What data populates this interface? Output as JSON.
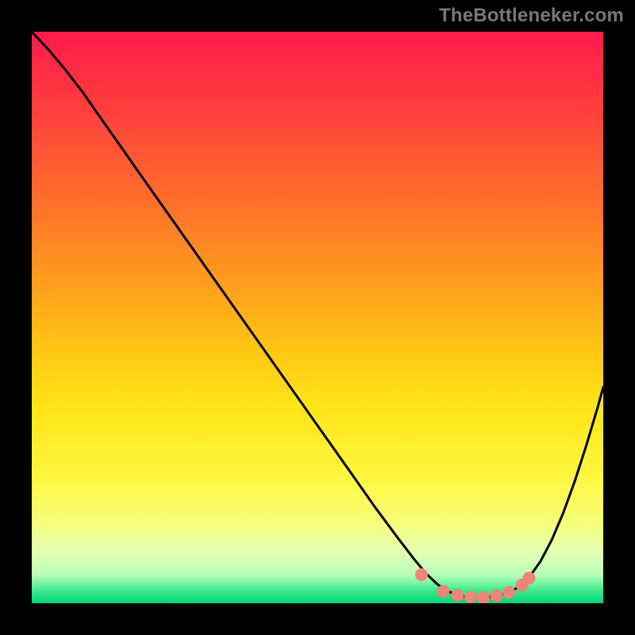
{
  "watermark": "TheBottleneker.com",
  "chart_data": {
    "type": "line",
    "title": "",
    "xlabel": "",
    "ylabel": "",
    "xlim": [
      0,
      1
    ],
    "ylim": [
      0,
      1
    ],
    "series": [
      {
        "name": "curve",
        "color": "#000000",
        "points": [
          [
            0.0,
            1.0
          ],
          [
            0.03,
            0.968
          ],
          [
            0.06,
            0.932
          ],
          [
            0.09,
            0.893
          ],
          [
            0.12,
            0.85
          ],
          [
            0.16,
            0.793
          ],
          [
            0.2,
            0.736
          ],
          [
            0.26,
            0.651
          ],
          [
            0.32,
            0.566
          ],
          [
            0.38,
            0.481
          ],
          [
            0.44,
            0.396
          ],
          [
            0.5,
            0.311
          ],
          [
            0.56,
            0.226
          ],
          [
            0.6,
            0.169
          ],
          [
            0.64,
            0.115
          ],
          [
            0.67,
            0.076
          ],
          [
            0.69,
            0.052
          ],
          [
            0.71,
            0.033
          ],
          [
            0.73,
            0.02
          ],
          [
            0.75,
            0.013
          ],
          [
            0.77,
            0.01
          ],
          [
            0.79,
            0.01
          ],
          [
            0.81,
            0.012
          ],
          [
            0.83,
            0.017
          ],
          [
            0.85,
            0.027
          ],
          [
            0.87,
            0.045
          ],
          [
            0.89,
            0.073
          ],
          [
            0.91,
            0.111
          ],
          [
            0.93,
            0.158
          ],
          [
            0.95,
            0.213
          ],
          [
            0.97,
            0.275
          ],
          [
            0.99,
            0.342
          ],
          [
            1.0,
            0.378
          ]
        ]
      }
    ],
    "markers": {
      "color": "#ee8577",
      "radius": 8,
      "points": [
        [
          0.682,
          0.05
        ],
        [
          0.72,
          0.021
        ],
        [
          0.745,
          0.014
        ],
        [
          0.768,
          0.011
        ],
        [
          0.79,
          0.01
        ],
        [
          0.813,
          0.013
        ],
        [
          0.835,
          0.019
        ],
        [
          0.858,
          0.032
        ],
        [
          0.87,
          0.044
        ]
      ]
    },
    "background_gradient": {
      "top": "#ff1a4d",
      "middle": "#ffe617",
      "bottom": "#00d47c"
    }
  }
}
